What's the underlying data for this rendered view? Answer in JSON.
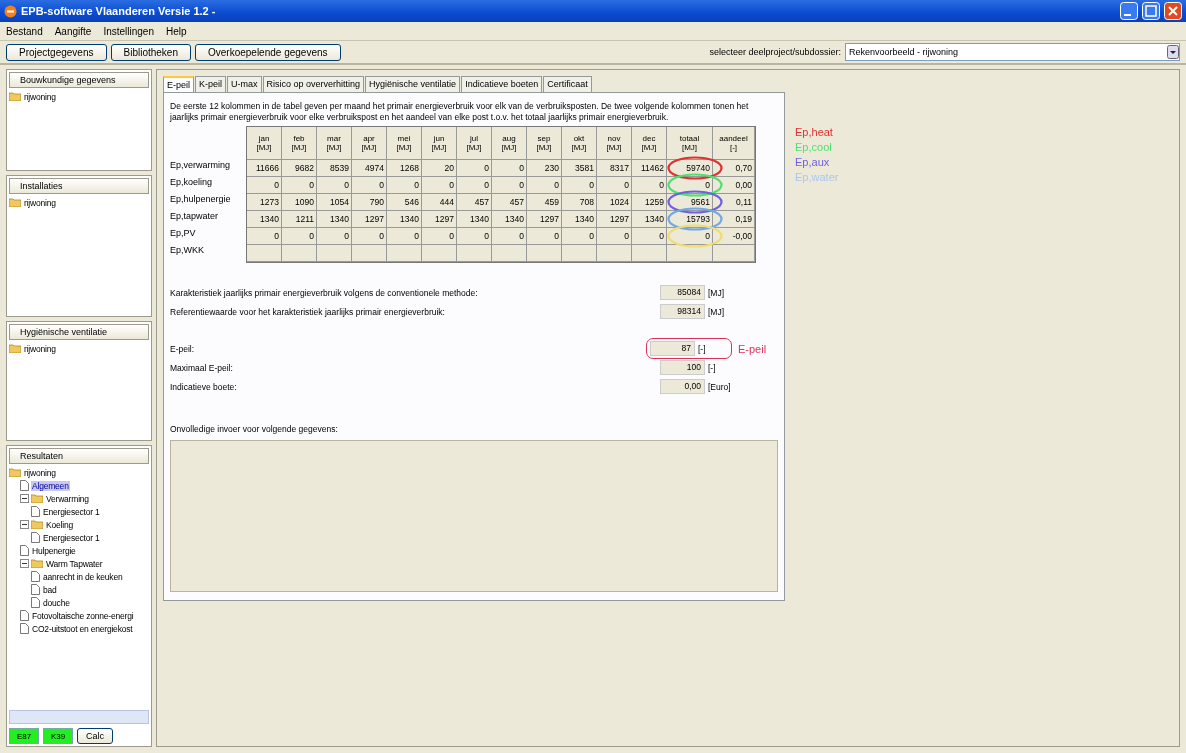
{
  "window": {
    "title": "EPB-software Vlaanderen Versie 1.2 -"
  },
  "menu": [
    "Bestand",
    "Aangifte",
    "Instellingen",
    "Help"
  ],
  "toolbar": {
    "buttons": [
      "Projectgegevens",
      "Bibliotheken",
      "Overkoepelende gegevens"
    ],
    "select_label": "selecteer deelproject/subdossier:",
    "select_value": "Rekenvoorbeeld - rijwoning"
  },
  "sidebar": [
    {
      "title": "Bouwkundige gegevens",
      "tree": [
        {
          "label": "rijwoning",
          "kind": "folder",
          "selected": false
        }
      ]
    },
    {
      "title": "Installaties",
      "tree": [
        {
          "label": "rijwoning",
          "kind": "folder",
          "selected": false
        }
      ]
    },
    {
      "title": "Hygiënische ventilatie",
      "tree": [
        {
          "label": "rijwoning",
          "kind": "folder",
          "selected": false
        }
      ]
    },
    {
      "title": "Resultaten",
      "tree": [
        {
          "label": "rijwoning",
          "kind": "folder",
          "selected": false,
          "children": [
            {
              "label": "Algemeen",
              "kind": "doc",
              "selected": true
            },
            {
              "label": "Verwarming",
              "kind": "folder",
              "expanded": true,
              "selected": false,
              "children": [
                {
                  "label": "Energiesector 1",
                  "kind": "doc",
                  "selected": false
                }
              ]
            },
            {
              "label": "Koeling",
              "kind": "folder",
              "expanded": true,
              "selected": false,
              "children": [
                {
                  "label": "Energiesector 1",
                  "kind": "doc",
                  "selected": false
                }
              ]
            },
            {
              "label": "Hulpenergie",
              "kind": "doc",
              "selected": false
            },
            {
              "label": "Warm Tapwater",
              "kind": "folder",
              "expanded": true,
              "selected": false,
              "children": [
                {
                  "label": "aanrecht in de keuken",
                  "kind": "doc",
                  "selected": false
                },
                {
                  "label": "bad",
                  "kind": "doc",
                  "selected": false
                },
                {
                  "label": "douche",
                  "kind": "doc",
                  "selected": false
                }
              ]
            },
            {
              "label": "Fotovoltaische zonne-energi",
              "kind": "doc",
              "selected": false
            },
            {
              "label": "CO2-uitstoot en energiekost",
              "kind": "doc",
              "selected": false
            }
          ]
        }
      ]
    }
  ],
  "status_buttons": [
    {
      "label": "E87",
      "kind": "indicator"
    },
    {
      "label": "K39",
      "kind": "indicator"
    },
    {
      "label": "Calc",
      "kind": "button"
    }
  ],
  "tabs": [
    {
      "label": "E-peil",
      "selected": true
    },
    {
      "label": "K-peil",
      "selected": false
    },
    {
      "label": "U-max",
      "selected": false
    },
    {
      "label": "Risico op oververhitting",
      "selected": false
    },
    {
      "label": "Hygiënische ventilatie",
      "selected": false
    },
    {
      "label": "Indicatieve boeten",
      "selected": false
    },
    {
      "label": "Certificaat",
      "selected": false
    }
  ],
  "description": "De eerste 12 kolommen in de tabel geven per maand het primair energieverbruik voor elk van de verbruiksposten. De twee volgende kolommen tonen het jaarlijks primair energieverbruik voor elke verbruikspost en het aandeel van elke post t.o.v. het totaal jaarlijks primair energieverbruik.",
  "table": {
    "columns": [
      {
        "name": "jan",
        "unit": "[MJ]"
      },
      {
        "name": "feb",
        "unit": "[MJ]"
      },
      {
        "name": "mar",
        "unit": "[MJ]"
      },
      {
        "name": "apr",
        "unit": "[MJ]"
      },
      {
        "name": "mei",
        "unit": "[MJ]"
      },
      {
        "name": "jun",
        "unit": "[MJ]"
      },
      {
        "name": "jul",
        "unit": "[MJ]"
      },
      {
        "name": "aug",
        "unit": "[MJ]"
      },
      {
        "name": "sep",
        "unit": "[MJ]"
      },
      {
        "name": "okt",
        "unit": "[MJ]"
      },
      {
        "name": "nov",
        "unit": "[MJ]"
      },
      {
        "name": "dec",
        "unit": "[MJ]"
      },
      {
        "name": "totaal",
        "unit": "[MJ]"
      },
      {
        "name": "aandeel",
        "unit": "[-]"
      }
    ],
    "rows": [
      {
        "label": "Ep,verwarming",
        "color": "#e03030",
        "cells": [
          "11666",
          "9682",
          "8539",
          "4974",
          "1268",
          "20",
          "0",
          "0",
          "230",
          "3581",
          "8317",
          "11462",
          "59740",
          "0,70"
        ]
      },
      {
        "label": "Ep,koeling",
        "color": "#50e070",
        "cells": [
          "0",
          "0",
          "0",
          "0",
          "0",
          "0",
          "0",
          "0",
          "0",
          "0",
          "0",
          "0",
          "0",
          "0,00"
        ]
      },
      {
        "label": "Ep,hulpenergie",
        "color": "#7060e0",
        "cells": [
          "1273",
          "1090",
          "1054",
          "790",
          "546",
          "444",
          "457",
          "457",
          "459",
          "708",
          "1024",
          "1259",
          "9561",
          "0,11"
        ]
      },
      {
        "label": "Ep,tapwater",
        "color": "#70a8e8",
        "cells": [
          "1340",
          "1211",
          "1340",
          "1297",
          "1340",
          "1297",
          "1340",
          "1340",
          "1297",
          "1340",
          "1297",
          "1340",
          "15793",
          "0,19"
        ]
      },
      {
        "label": "Ep,PV",
        "color": "#f0dc70",
        "cells": [
          "0",
          "0",
          "0",
          "0",
          "0",
          "0",
          "0",
          "0",
          "0",
          "0",
          "0",
          "0",
          "0",
          "-0,00"
        ]
      },
      {
        "label": "Ep,WKK",
        "cells": []
      }
    ]
  },
  "annotations": [
    {
      "label": "Ep,heat",
      "color": "#e03030"
    },
    {
      "label": "Ep,cool",
      "color": "#50e070"
    },
    {
      "label": "Ep,aux",
      "color": "#7060e0"
    },
    {
      "label": "Ep,water",
      "color": "#a8c8ec"
    }
  ],
  "results": [
    [
      {
        "label": "Karakteristiek jaarlijks primair energieverbruik volgens de conventionele methode:",
        "value": "85084",
        "unit": "[MJ]"
      },
      {
        "label": "Referentiewaarde voor het karakteristiek jaarlijks primair energieverbruik:",
        "value": "98314",
        "unit": "[MJ]"
      }
    ],
    [
      {
        "label": "E-peil:",
        "value": "87",
        "unit": "[-]",
        "highlight": {
          "label": "E-peil",
          "color": "#e0305a"
        }
      },
      {
        "label": "Maximaal E-peil:",
        "value": "100",
        "unit": "[-]"
      },
      {
        "label": "Indicatieve boete:",
        "value": "0,00",
        "unit": "[Euro]"
      }
    ]
  ],
  "incomplete_label": "Onvolledige invoer voor volgende gegevens:"
}
